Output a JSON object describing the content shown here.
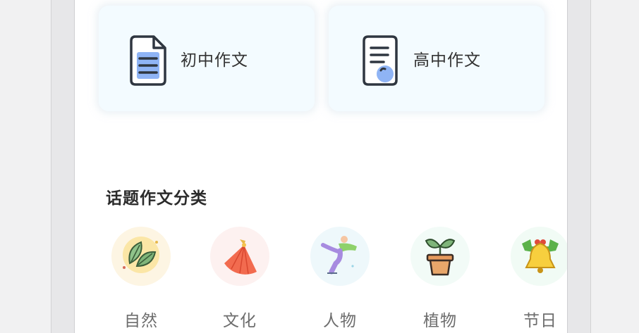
{
  "cards": [
    {
      "label": "初中作文",
      "icon": "document-lines-icon"
    },
    {
      "label": "高中作文",
      "icon": "document-check-icon"
    }
  ],
  "section": {
    "title": "话题作文分类"
  },
  "categories": [
    {
      "label": "自然",
      "icon": "leaves-icon"
    },
    {
      "label": "文化",
      "icon": "folding-fan-icon"
    },
    {
      "label": "人物",
      "icon": "figure-skater-icon"
    },
    {
      "label": "植物",
      "icon": "potted-plant-icon"
    },
    {
      "label": "节日",
      "icon": "christmas-bell-icon"
    }
  ],
  "colors": {
    "card_bg": "#f3fbff",
    "accent_blue": "#7fa8f0",
    "text_dark": "#333333",
    "text_grey": "#6d6d6d"
  }
}
